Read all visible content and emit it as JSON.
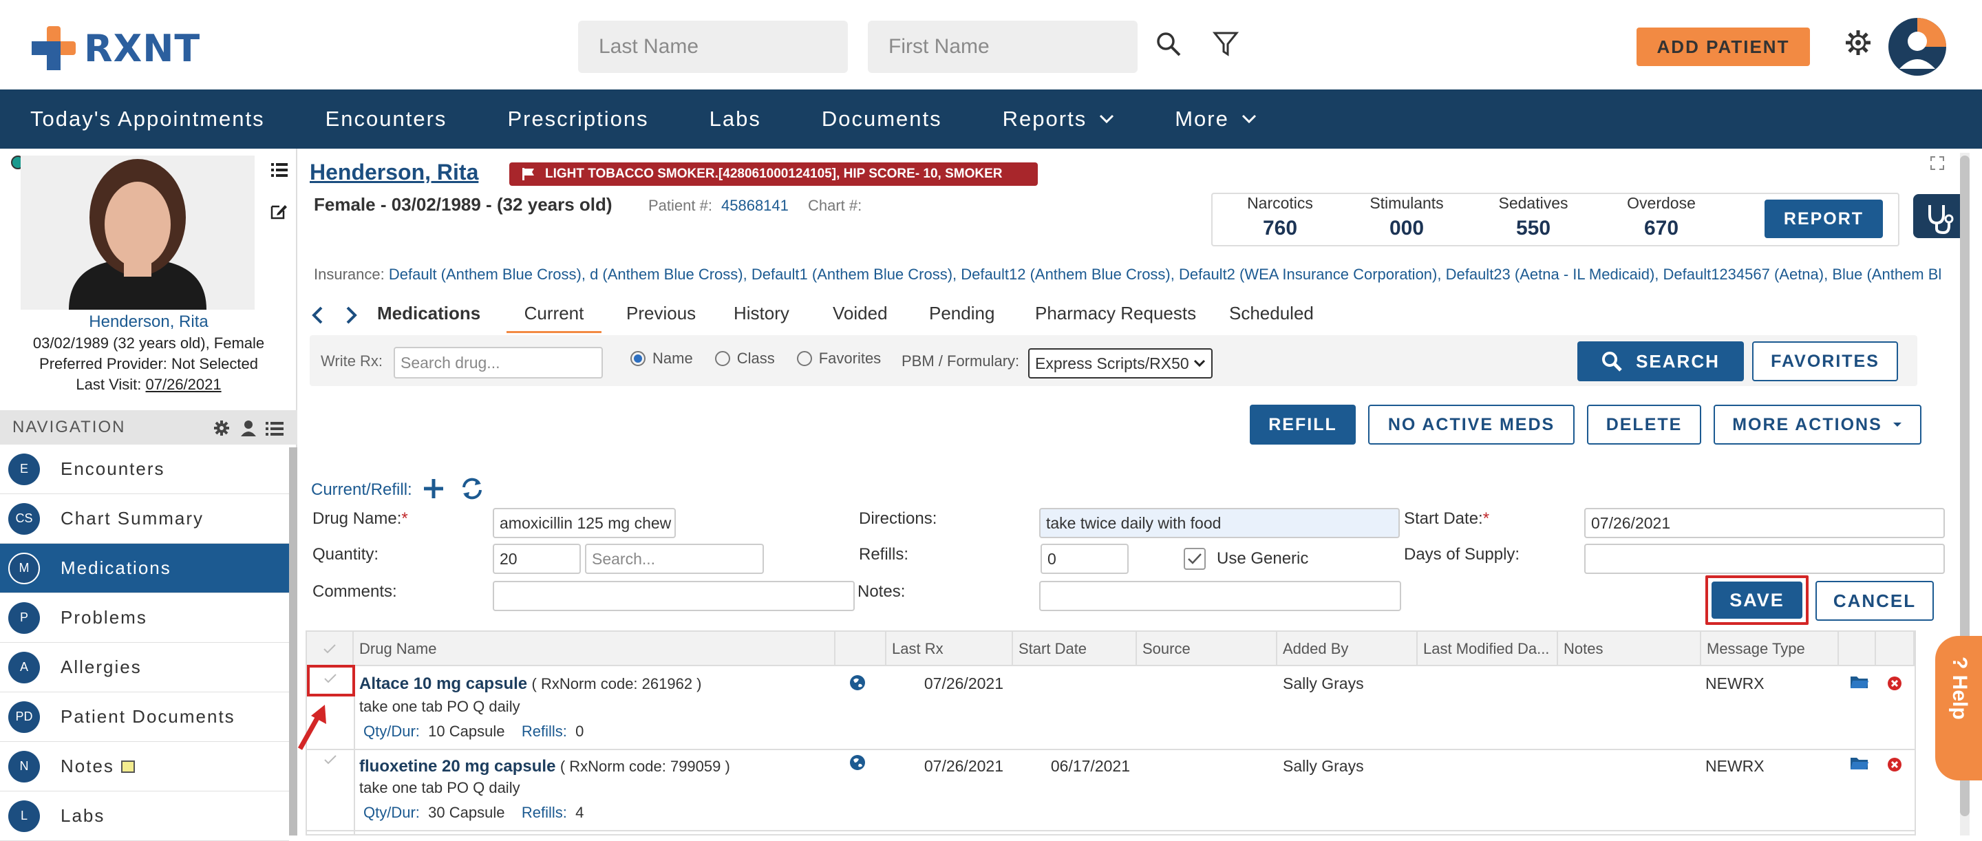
{
  "app": {
    "logo": "RXNT"
  },
  "search": {
    "last_name_placeholder": "Last Name",
    "first_name_placeholder": "First Name"
  },
  "header": {
    "add_patient": "ADD PATIENT"
  },
  "nav": {
    "items": [
      "Today's Appointments",
      "Encounters",
      "Prescriptions",
      "Labs",
      "Documents",
      "Reports",
      "More"
    ]
  },
  "patient": {
    "name": "Henderson, Rita",
    "dob_line": "03/02/1989 (32 years old), Female",
    "provider": "Preferred Provider: Not Selected",
    "last_visit_label": "Last Visit:",
    "last_visit": "07/26/2021",
    "header_name": "Henderson, Rita",
    "alert": "LIGHT TOBACCO SMOKER.[428061000124105], HIP SCORE- 10, SMOKER",
    "demo": "Female - 03/02/1989 - (32 years old)",
    "patient_num_label": "Patient #:",
    "patient_num": "45868141",
    "chart_label": "Chart #:",
    "insurance_label": "Insurance:",
    "insurance": "Default (Anthem Blue Cross), d (Anthem Blue Cross), Default1 (Anthem Blue Cross), Default12 (Anthem Blue Cross), Default2 (WEA Insurance Corporation), Default23 (Aetna - IL Medicaid), Default1234567 (Aetna), Blue (Anthem Bl"
  },
  "drugstats": [
    {
      "t": "Narcotics",
      "v": "760"
    },
    {
      "t": "Stimulants",
      "v": "000"
    },
    {
      "t": "Sedatives",
      "v": "550"
    },
    {
      "t": "Overdose",
      "v": "670"
    }
  ],
  "report_btn": "REPORT",
  "leftnav": {
    "header": "NAVIGATION",
    "items": [
      {
        "c": "E",
        "l": "Encounters"
      },
      {
        "c": "CS",
        "l": "Chart Summary"
      },
      {
        "c": "M",
        "l": "Medications"
      },
      {
        "c": "P",
        "l": "Problems"
      },
      {
        "c": "A",
        "l": "Allergies"
      },
      {
        "c": "PD",
        "l": "Patient Documents"
      },
      {
        "c": "N",
        "l": "Notes"
      },
      {
        "c": "L",
        "l": "Labs"
      }
    ]
  },
  "tabs": {
    "section": "Medications",
    "items": [
      "Current",
      "Previous",
      "History",
      "Voided",
      "Pending",
      "Pharmacy Requests",
      "Scheduled"
    ]
  },
  "rx": {
    "write_label": "Write Rx:",
    "search_placeholder": "Search drug...",
    "radio": [
      "Name",
      "Class",
      "Favorites"
    ],
    "pbm_label": "PBM / Formulary:",
    "pbm_value": "Express Scripts/RX50",
    "search_btn": "SEARCH",
    "fav_btn": "FAVORITES"
  },
  "actions": {
    "refill": "REFILL",
    "no_active": "NO ACTIVE MEDS",
    "delete": "DELETE",
    "more": "MORE ACTIONS"
  },
  "form": {
    "title": "Current/Refill:",
    "drug_name_label": "Drug Name:",
    "drug_name": "amoxicillin 125 mg chew",
    "quantity_label": "Quantity:",
    "quantity": "20",
    "qty_search_placeholder": "Search...",
    "comments_label": "Comments:",
    "directions_label": "Directions:",
    "directions": "take twice daily with food",
    "refills_label": "Refills:",
    "refills": "0",
    "use_generic": "Use Generic",
    "notes_label": "Notes:",
    "start_label": "Start Date:",
    "start": "07/26/2021",
    "days_label": "Days of Supply:",
    "save": "SAVE",
    "cancel": "CANCEL"
  },
  "table": {
    "headers": [
      "Drug Name",
      "Last Rx",
      "Start Date",
      "Source",
      "Added By",
      "Last Modified Da...",
      "Notes",
      "Message Type"
    ],
    "rows": [
      {
        "drug": "Altace 10 mg capsule",
        "code": "( RxNorm code: 261962 )",
        "sig": "take one tab PO Q daily",
        "qty_label": "Qty/Dur:",
        "qty": "10 Capsule",
        "ref_label": "Refills:",
        "ref": "0",
        "last_rx": "07/26/2021",
        "start": "",
        "added": "Sally Grays",
        "msg": "NEWRX"
      },
      {
        "drug": "fluoxetine 20 mg capsule",
        "code": "( RxNorm code: 799059 )",
        "sig": "take one tab PO Q daily",
        "qty_label": "Qty/Dur:",
        "qty": "30 Capsule",
        "ref_label": "Refills:",
        "ref": "4",
        "last_rx": "07/26/2021",
        "start": "06/17/2021",
        "added": "Sally Grays",
        "msg": "NEWRX"
      }
    ]
  },
  "help": "? Help"
}
